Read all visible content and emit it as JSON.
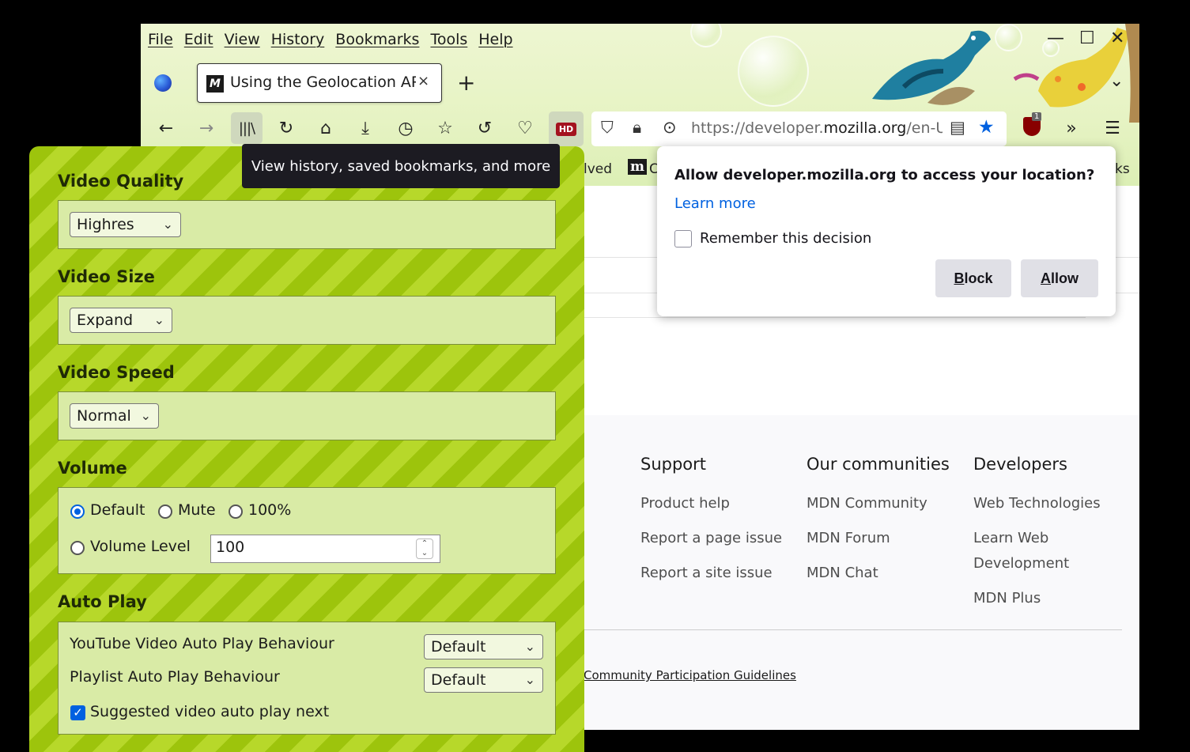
{
  "menubar": {
    "items": [
      "File",
      "Edit",
      "View",
      "History",
      "Bookmarks",
      "Tools",
      "Help"
    ]
  },
  "window_controls": {
    "minimize": "—",
    "maximize": "☐",
    "close": "✕"
  },
  "tab": {
    "favicon_letter": "M",
    "title": "Using the Geolocation API",
    "close": "×",
    "new_tab": "+"
  },
  "toolbar": {
    "hd_badge": "HD",
    "url_prefix": "https://developer.",
    "url_domain": "mozilla.org",
    "url_suffix": "/en-U",
    "ublock_badge": "1"
  },
  "bookmarks": {
    "partial_1": "lved",
    "mdn_icon": "m",
    "partial_2": "C",
    "partial_3": "ks"
  },
  "tooltip": {
    "text": "View history, saved bookmarks, and more"
  },
  "permission": {
    "title": "Allow developer.mozilla.org to access your location?",
    "learn_more": "Learn more",
    "remember": "Remember this decision",
    "block_label_underlined": "B",
    "block_label_rest": "lock",
    "allow_label_underlined": "A",
    "allow_label_rest": "llow"
  },
  "footer": {
    "support": {
      "heading": "Support",
      "links": [
        "Product help",
        "Report a page issue",
        "Report a site issue"
      ]
    },
    "communities": {
      "heading": "Our communities",
      "links": [
        "MDN Community",
        "MDN Forum",
        "MDN Chat"
      ]
    },
    "developers": {
      "heading": "Developers",
      "links": [
        "Web Technologies",
        "Learn Web Development",
        "MDN Plus"
      ]
    },
    "guidelines": "Community Participation Guidelines"
  },
  "panel": {
    "video_quality": {
      "heading": "Video Quality",
      "value": "Highres"
    },
    "video_size": {
      "heading": "Video Size",
      "value": "Expand"
    },
    "video_speed": {
      "heading": "Video Speed",
      "value": "Normal"
    },
    "volume": {
      "heading": "Volume",
      "options": [
        "Default",
        "Mute",
        "100%"
      ],
      "selected": "Default",
      "level_label": "Volume Level",
      "level_value": "100"
    },
    "auto_play": {
      "heading": "Auto Play",
      "youtube_label": "YouTube Video Auto Play Behaviour",
      "youtube_value": "Default",
      "playlist_label": "Playlist Auto Play Behaviour",
      "playlist_value": "Default",
      "suggested_label": "Suggested video auto play next",
      "suggested_checked": true
    }
  },
  "colors": {
    "accent": "#0061e0",
    "panel_stripe_dark": "#9dc40c",
    "panel_stripe_light": "#b7d82a",
    "tooltip_bg": "#1c1b22"
  }
}
